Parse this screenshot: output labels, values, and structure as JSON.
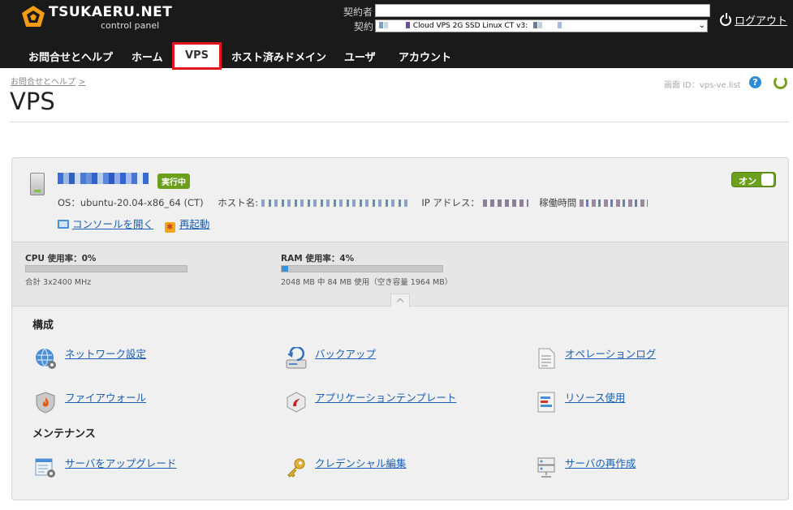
{
  "header": {
    "logo_text": "TSUKAERU.NET",
    "logo_sub": "control panel",
    "contractor_label": "契約者",
    "contract_label": "契約",
    "contract_value": "Cloud VPS 2G SSD Linux CT v3:",
    "logout_label": "ログアウト"
  },
  "nav": {
    "items": [
      "お問合せとヘルプ",
      "ホーム",
      "VPS",
      "ホスト済みドメイン",
      "ユーザ",
      "アカウント"
    ],
    "active": "VPS"
  },
  "page": {
    "breadcrumb": "お問合せとヘルプ",
    "breadcrumb_sep": ">",
    "title": "VPS",
    "screen_id_label": "画面 ID：",
    "screen_id": "vps-ve.list",
    "help_label": "?"
  },
  "server": {
    "status": "実行中",
    "toggle_label": "オン",
    "os_label": "OS：",
    "os_value": "ubuntu-20.04-x86_64 (CT)",
    "host_label": "ホスト名:",
    "ip_label": "IP アドレス：",
    "uptime_label": "稼働時間",
    "console_link": "コンソールを開く",
    "reboot_link": "再起動"
  },
  "stats": {
    "cpu_title": "CPU 使用率：0%",
    "cpu_percent": 0,
    "cpu_sub": "合計 3x2400 MHz",
    "ram_title": "RAM 使用率：4%",
    "ram_percent": 4,
    "ram_sub": "2048 MB 中 84 MB 使用（空き容量 1964 MB）"
  },
  "sections": {
    "config_title": "構成",
    "maintenance_title": "メンテナンス",
    "config_links": [
      "ネットワーク設定",
      "バックアップ",
      "オペレーションログ",
      "ファイアウォール",
      "アプリケーションテンプレート",
      "リソース使用"
    ],
    "maintenance_links": [
      "サーバをアップグレード",
      "クレデンシャル編集",
      "サーバの再作成"
    ]
  },
  "colors": {
    "accent_green": "#6c9f1e",
    "link_blue": "#1a5fb4",
    "nav_highlight": "#e0151d",
    "header_bg": "#1a1a1a"
  }
}
